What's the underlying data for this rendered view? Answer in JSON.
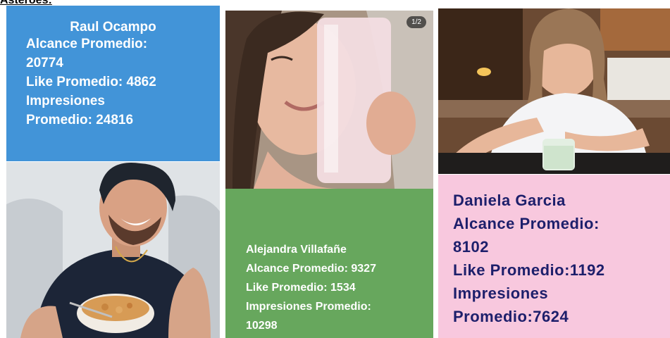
{
  "header": {
    "title": "Asteroes:"
  },
  "cards": [
    {
      "name": "Raul Ocampo",
      "alcance_line1": "Alcance Promedio:",
      "alcance_line2": "20774",
      "like": "Like Promedio: 4862",
      "impresiones_line1": "Impresiones",
      "impresiones_line2": "Promedio: 24816",
      "color": "#4294d8"
    },
    {
      "name": "Alejandra Villafañe",
      "alcance": "Alcance Promedio: 9327",
      "like": "Like Promedio: 1534",
      "impresiones_line1": "Impresiones Promedio:",
      "impresiones_line2": "10298",
      "photo_badge": "1/2",
      "color": "#67a75d"
    },
    {
      "name": "Daniela Garcia",
      "alcance_line1": "Alcance Promedio:",
      "alcance_line2": "8102",
      "like": "Like Promedio:1192",
      "impresiones_line1": "Impresiones",
      "impresiones_line2": "Promedio:7624",
      "color": "#f8c8de"
    }
  ]
}
